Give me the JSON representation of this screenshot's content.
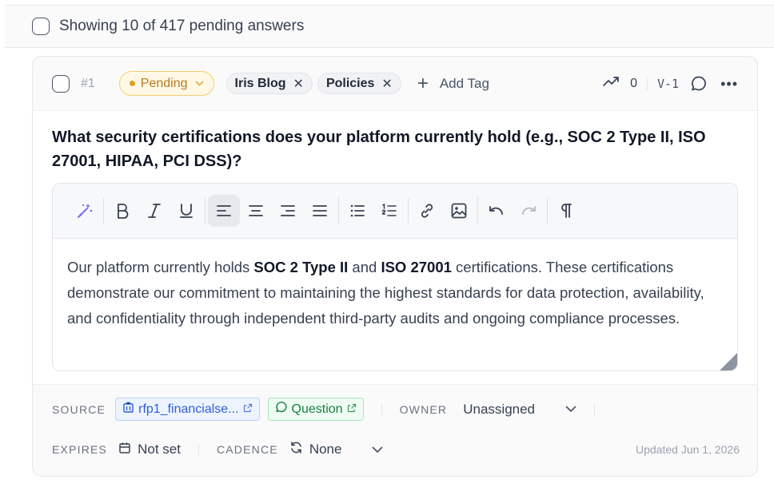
{
  "list_header": {
    "label": "Showing 10 of 417 pending answers"
  },
  "item": {
    "number": "#1",
    "status": {
      "label": "Pending",
      "color": "#b7791f"
    },
    "tags": [
      {
        "label": "Iris Blog"
      },
      {
        "label": "Policies"
      }
    ],
    "add_tag_label": "Add Tag",
    "trend_count": "0",
    "version": "V-1",
    "question": "What security certifications does your platform currently hold (e.g., SOC 2 Type II, ISO 27001, HIPAA, PCI DSS)?",
    "answer": {
      "p1": "Our platform currently holds ",
      "b1": "SOC 2 Type II",
      "p2": " and ",
      "b2": "ISO 27001",
      "p3": " certifications. These certifications demonstrate our commitment to maintaining the highest standards for data protection, availability, and confidentiality through independent third-party audits and ongoing compliance processes."
    },
    "toolbar_icons": [
      "magic-wand-icon",
      "bold-icon",
      "italic-icon",
      "underline-icon",
      "align-left-icon",
      "align-center-icon",
      "align-right-icon",
      "align-justify-icon",
      "bullet-list-icon",
      "numbered-list-icon",
      "link-icon",
      "image-icon",
      "undo-icon",
      "redo-icon",
      "pilcrow-icon"
    ],
    "footer": {
      "source_label": "SOURCE",
      "source_file": "rfp1_financialse...",
      "source_type": "Question",
      "owner_label": "OWNER",
      "owner_value": "Unassigned",
      "expires_label": "EXPIRES",
      "expires_value": "Not set",
      "cadence_label": "CADENCE",
      "cadence_value": "None",
      "updated": "Updated Jun 1, 2026"
    }
  },
  "colors": {
    "accent": "#7c6cf0",
    "pending_bg": "#fff8e5",
    "source_blue": "#2f5fd6",
    "question_green": "#16803c"
  }
}
